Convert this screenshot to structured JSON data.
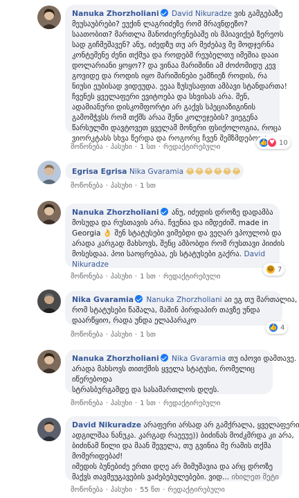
{
  "actions": {
    "like": "მოწონება",
    "reply": "პასუხი",
    "edited": "რედაქტირებული"
  },
  "comments": [
    {
      "author": "Nanuka Zhorzholiani",
      "verified": true,
      "mention": "David Nikuradze",
      "lines": [
        "ვის გამგებაზე",
        "მეუსაუბრები? ეუქინ ლაგრიძეზე რომ მრავნდეზო?",
        "საათობით? მართლა მანოძიერენებაშე ის მპიავიქებ ზერეოს",
        "სად გიჩმეშავენ? ანუ, იძედზუ თუ არ მეძებავ მე მოდჯერნა",
        "კონტემენე ძენი თქმუა და როდებშ რეუბელთუ იმეშია დააი",
        "დოლარიანი ყოყო?? და ვინაა მარიშინი ამ ძოძომიდუ კევ",
        "გოვიდე და როდის იყო მარიშინები ეამჩიეზ როდის, რა",
        "ნიუსი ეუბისად ვიდეუდა. ეეაა ზუსუსაფით ამბავი სტანდართა!",
        "ჩვენეს ყველაფერი ევიტოება და სხვისას არა. შენ,",
        "ადამიანური დისკომფორტი არ გაქვს სპეციაზიგინის",
        "გამომჭვსს რომ თქმს არაა შენი კოლეჯების? ვიეგენა",
        "წარსულში დავტოვეთ ყველამ მონერი ფსიქოლოგია, როცა",
        "ვიორკტასს სხვა წერდა და როგორც ჩვენ შემზმდებოდა"
      ],
      "time": "1 სთ",
      "reactions": {
        "count": "10"
      }
    },
    {
      "author": "Egrisa Egrisa",
      "verified": false,
      "mention": "Nika Gvaramia",
      "emoji": "😂😂😂😂😂😂",
      "lines": [],
      "time": "1 სთ"
    },
    {
      "author": "Nanuka Zhorzholiani",
      "verified": true,
      "first_text": "ანუ, იძედის დროზე დადამბა",
      "lines": [
        "მოსუდა და რუსთავის არა. ჩვენია და იმდეძიშ. made in",
        "Georgia 👌 შენ სტატუსები ვიმებდი და ვეღარ ვპოულობ და",
        "არადა კარგად მახსოვს, შენც ამბობდი რომ რუსთავი პიიძის",
        "მოსესდაა. პოი საოცრებაა, ეს სტატუსები გაქრა."
      ],
      "trailing_mention_inline": "David",
      "trailing_mention": "Nikuradze",
      "time": "1 სთ",
      "reactions": {
        "count": "7"
      }
    },
    {
      "author": "Nika Gvaramia",
      "verified": true,
      "mention": "Nanuka Zhorzholiani",
      "first_text": "აი ეგ თუ მართალია,",
      "lines": [
        "რომ სტატუსები წაშალა, მაშინ პირდაპირ თავზე უნდა",
        "დაარწყიო, რადა უნდა ელაპარაკო"
      ],
      "time": "1 სთ",
      "reactions": {
        "count": "4"
      }
    },
    {
      "author": "Nanuka Zhorzholiani",
      "verified": true,
      "mention": "Nika Gvaramia",
      "first_text": "თუ იპოვი დამთავე.",
      "lines": [
        "არადა მახსოვს თითქმის ყველა სტატუსი, რომელიც",
        "იწერებოდა",
        "სტრასბურგამდე და სასამართლოს დღეს."
      ],
      "time": "1 სთ"
    },
    {
      "author": "David Nikuradze",
      "verified": false,
      "first_text": "არაფერი არსად არ გამქრალა, ყველაფერი",
      "lines": [
        "ადგილშაა ნანუკა. კარგად რაეეუე)) ბიძინას მოძკმრდა კი არა,",
        "ბიძინამ წილი და მაან შეველა, თუ გვინია მე რამის თქმა",
        "მომერიდებაძ!",
        "იმედის ბუნებიძე ერთი დღე არ მიმუშავია და არც დროზე",
        "მაქვს თავმეუგავების ვაძებებულებები. ვიდ..."
      ],
      "see_more": "იხილეთ მეტი",
      "time": "55 წთ"
    }
  ]
}
